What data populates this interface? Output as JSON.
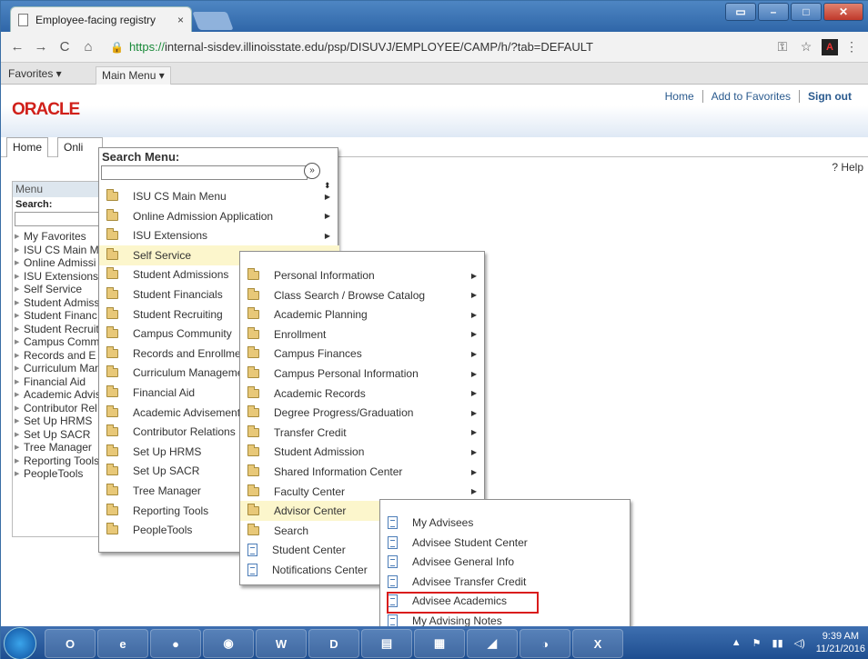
{
  "browser": {
    "tab_title": "Employee-facing registry",
    "tab_close": "×",
    "url_scheme": "https://",
    "url_rest": "internal-sisdev.illinoisstate.edu/psp/DISUVJ/EMPLOYEE/CAMP/h/?tab=DEFAULT"
  },
  "favbar": {
    "favorites": "Favorites ▾",
    "main_menu": "Main Menu ▾"
  },
  "header": {
    "logo": "ORACLE",
    "links": [
      "Home",
      "Add to Favorites",
      "Sign out"
    ]
  },
  "tabs": [
    "Home",
    "Onli"
  ],
  "help": "? Help",
  "left_menu": {
    "title": "Menu",
    "search_label": "Search:",
    "items": [
      "My Favorites",
      "ISU CS Main M",
      "Online Admissi",
      "ISU Extensions",
      "Self Service",
      "Student Admiss",
      "Student Financ",
      "Student Recruit",
      "Campus Comm",
      "Records and E",
      "Curriculum Mar",
      "Financial Aid",
      "Academic Advis",
      "Contributor Rel",
      "Set Up HRMS",
      "Set Up SACR",
      "Tree Manager",
      "Reporting Tools",
      "PeopleTools"
    ]
  },
  "menu1": {
    "title": "Search Menu:",
    "go": "»",
    "sort": "⬍",
    "items": [
      {
        "label": "ISU CS Main Menu",
        "sub": true
      },
      {
        "label": "Online Admission Application",
        "sub": true
      },
      {
        "label": "ISU Extensions",
        "sub": true
      },
      {
        "label": "Self Service",
        "sub": true,
        "highlight": true
      },
      {
        "label": "Student Admissions",
        "sub": false
      },
      {
        "label": "Student Financials",
        "sub": false
      },
      {
        "label": "Student Recruiting",
        "sub": false
      },
      {
        "label": "Campus Community",
        "sub": false
      },
      {
        "label": "Records and Enrollment",
        "sub": false
      },
      {
        "label": "Curriculum Management",
        "sub": false
      },
      {
        "label": "Financial Aid",
        "sub": false
      },
      {
        "label": "Academic Advisement",
        "sub": false
      },
      {
        "label": "Contributor Relations",
        "sub": false
      },
      {
        "label": "Set Up HRMS",
        "sub": false
      },
      {
        "label": "Set Up SACR",
        "sub": false
      },
      {
        "label": "Tree Manager",
        "sub": false
      },
      {
        "label": "Reporting Tools",
        "sub": false
      },
      {
        "label": "PeopleTools",
        "sub": false
      }
    ]
  },
  "menu2": {
    "items": [
      {
        "label": "Personal Information",
        "type": "folder",
        "sub": true
      },
      {
        "label": "Class Search / Browse Catalog",
        "type": "folder",
        "sub": true
      },
      {
        "label": "Academic Planning",
        "type": "folder",
        "sub": true
      },
      {
        "label": "Enrollment",
        "type": "folder",
        "sub": true
      },
      {
        "label": "Campus Finances",
        "type": "folder",
        "sub": true
      },
      {
        "label": "Campus Personal Information",
        "type": "folder",
        "sub": true
      },
      {
        "label": "Academic Records",
        "type": "folder",
        "sub": true
      },
      {
        "label": "Degree Progress/Graduation",
        "type": "folder",
        "sub": true
      },
      {
        "label": "Transfer Credit",
        "type": "folder",
        "sub": true
      },
      {
        "label": "Student Admission",
        "type": "folder",
        "sub": true
      },
      {
        "label": "Shared Information Center",
        "type": "folder",
        "sub": true
      },
      {
        "label": "Faculty Center",
        "type": "folder",
        "sub": true
      },
      {
        "label": "Advisor Center",
        "type": "folder",
        "sub": true,
        "highlight": true
      },
      {
        "label": "Search",
        "type": "folder",
        "sub": false
      },
      {
        "label": "Student Center",
        "type": "doc",
        "sub": false
      },
      {
        "label": "Notifications Center",
        "type": "doc",
        "sub": false
      }
    ]
  },
  "menu3": {
    "items": [
      "My Advisees",
      "Advisee Student Center",
      "Advisee General Info",
      "Advisee Transfer Credit",
      "Advisee Academics",
      "My Advising Notes"
    ]
  },
  "taskbar": {
    "apps": [
      "O",
      "e",
      "●",
      "◉",
      "W",
      "D",
      "▤",
      "▦",
      "◢",
      "◑",
      "X"
    ],
    "time": "9:39 AM",
    "date": "11/21/2016"
  },
  "colors": {
    "highlight": "#fcf6cc",
    "callout": "#d91c1c",
    "oracle_red": "#d0201a"
  }
}
